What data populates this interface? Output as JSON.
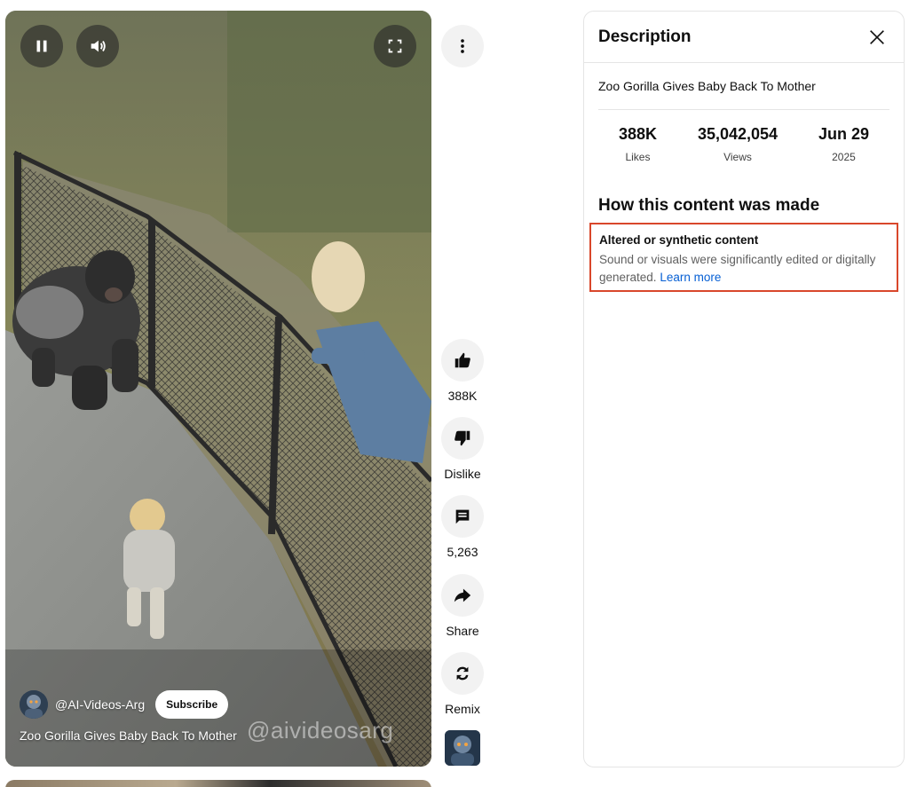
{
  "video": {
    "channel_name": "@AI-Videos-Arg",
    "subscribe_label": "Subscribe",
    "title": "Zoo Gorilla Gives Baby Back To Mother",
    "watermark": "@aivideosarg",
    "controls": {
      "pause_icon": "pause-icon",
      "volume_icon": "volume-icon",
      "fullscreen_icon": "fullscreen-icon"
    }
  },
  "actions": {
    "more_icon": "more-vert-icon",
    "like": {
      "icon": "thumb-up-icon",
      "label": "388K"
    },
    "dislike": {
      "icon": "thumb-down-icon",
      "label": "Dislike"
    },
    "comment": {
      "icon": "comment-icon",
      "label": "5,263"
    },
    "share": {
      "icon": "share-icon",
      "label": "Share"
    },
    "remix": {
      "icon": "remix-icon",
      "label": "Remix"
    }
  },
  "description_panel": {
    "title": "Description",
    "video_title": "Zoo Gorilla Gives Baby Back To Mother",
    "stats": [
      {
        "value": "388K",
        "label": "Likes"
      },
      {
        "value": "35,042,054",
        "label": "Views"
      },
      {
        "value": "Jun 29",
        "label": "2025"
      }
    ],
    "how_made_heading": "How this content was made",
    "altered": {
      "title": "Altered or synthetic content",
      "body": "Sound or visuals were significantly edited or digitally generated.",
      "link": "Learn more"
    }
  },
  "colors": {
    "highlight_border": "#d9472b",
    "link": "#065fd4",
    "button_bg": "#f2f2f2"
  }
}
